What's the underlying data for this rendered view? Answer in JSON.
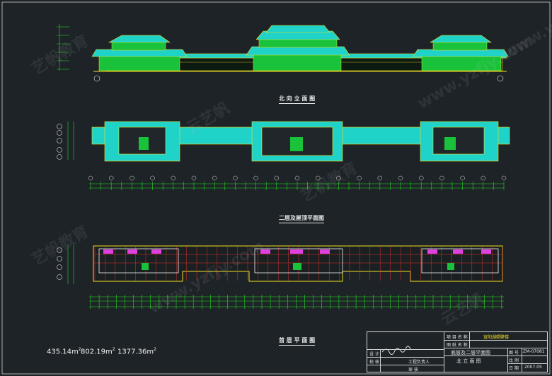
{
  "views": {
    "elevation": {
      "caption": "北 向 立 面 图"
    },
    "upper_plan": {
      "caption": "二层及屋顶平面图"
    },
    "ground_plan": {
      "caption": "首 层 平 面 图"
    }
  },
  "areas": [
    {
      "value": "435.14m",
      "sup": "2"
    },
    {
      "value": "802.19m",
      "sup": "2"
    },
    {
      "value": "1377.36m",
      "sup": "2"
    }
  ],
  "title_block": {
    "project_label": "项 目 名 称",
    "project_name": "宣阳湖照壁楼",
    "drawing_label": "图 纸 名 称",
    "drawing_name_1": "底层及二层平面图",
    "drawing_name_2": "北 立 面 图",
    "design_label": "设 计",
    "check_label": "校 核",
    "review_label": "审 核",
    "owner_label": "工程负责人",
    "sheet_no_label": "图 号",
    "sheet_no": "ZM-07081",
    "scale_label": "比 例",
    "date_label": "日 期",
    "date": "2007.05"
  },
  "colors": {
    "background": "#1e2327",
    "roof_cyan": "#1fd3c8",
    "roof_edge_yellow": "#f0e020",
    "wall_green": "#19c23a",
    "grid_red": "#e0312b",
    "dim_green": "#22dd22",
    "stair_magenta": "#e040e0"
  }
}
